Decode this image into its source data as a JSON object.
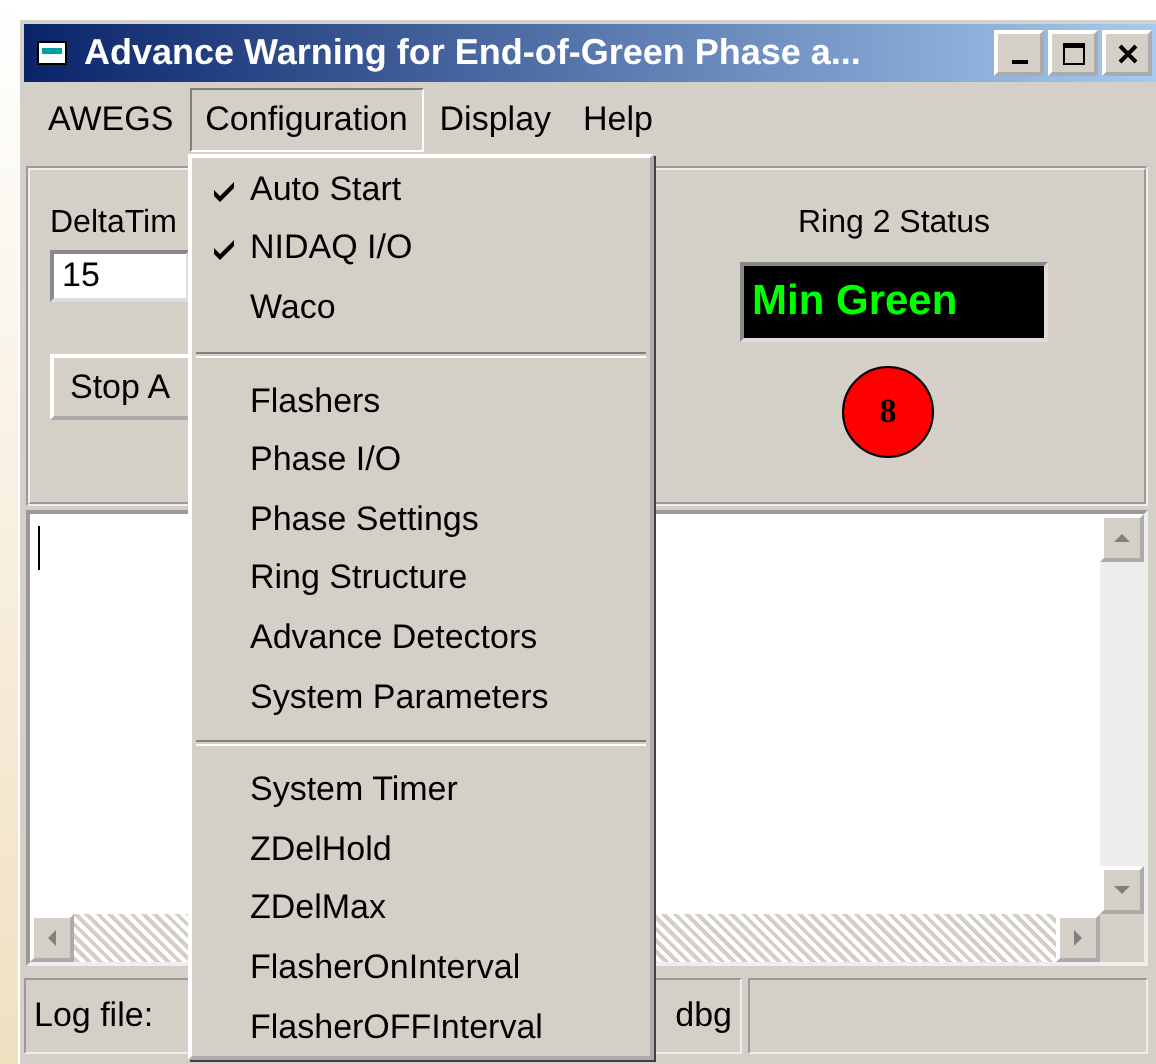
{
  "window": {
    "title": "Advance Warning for End-of-Green Phase a..."
  },
  "menu_bar": [
    {
      "label": "AWEGS",
      "selected": false
    },
    {
      "label": "Configuration",
      "selected": true
    },
    {
      "label": "Display",
      "selected": false
    },
    {
      "label": "Help",
      "selected": false
    }
  ],
  "dropdown": [
    {
      "kind": "item",
      "label": "Auto Start",
      "checked": true
    },
    {
      "kind": "item",
      "label": "NIDAQ I/O",
      "checked": true
    },
    {
      "kind": "item",
      "label": "Waco",
      "checked": false
    },
    {
      "kind": "separator"
    },
    {
      "kind": "item",
      "label": "Flashers",
      "checked": false
    },
    {
      "kind": "item",
      "label": "Phase I/O",
      "checked": false
    },
    {
      "kind": "item",
      "label": "Phase Settings",
      "checked": false
    },
    {
      "kind": "item",
      "label": "Ring Structure",
      "checked": false
    },
    {
      "kind": "item",
      "label": "Advance Detectors",
      "checked": false
    },
    {
      "kind": "item",
      "label": "System Parameters",
      "checked": false
    },
    {
      "kind": "separator"
    },
    {
      "kind": "item",
      "label": "System Timer",
      "checked": false
    },
    {
      "kind": "item",
      "label": "ZDelHold",
      "checked": false
    },
    {
      "kind": "item",
      "label": "ZDelMax",
      "checked": false
    },
    {
      "kind": "item",
      "label": "FlasherOnInterval",
      "checked": false
    },
    {
      "kind": "item",
      "label": "FlasherOFFInterval",
      "checked": false
    }
  ],
  "controls": {
    "delta_label": "DeltaTim",
    "delta_value": "15",
    "stop_button": "Stop A"
  },
  "ring_status": {
    "label": "Ring 2 Status",
    "state": "Min Green",
    "phase": "8",
    "color": "#ff0000"
  },
  "status_bar": {
    "log_start": "Log file:",
    "log_end": "dbg"
  }
}
